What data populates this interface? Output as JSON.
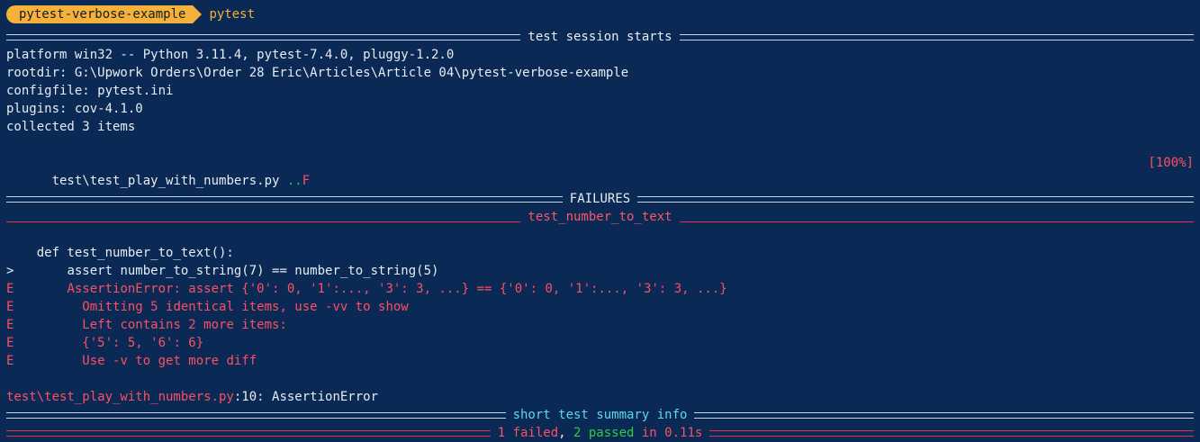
{
  "prompt": {
    "directory": "pytest-verbose-example",
    "command": "pytest"
  },
  "session": {
    "title": "test session starts",
    "platform": "platform win32 -- Python 3.11.4, pytest-7.4.0, pluggy-1.2.0",
    "rootdir": "rootdir: G:\\Upwork Orders\\Order 28 Eric\\Articles\\Article 04\\pytest-verbose-example",
    "configfile": "configfile: pytest.ini",
    "plugins": "plugins: cov-4.1.0",
    "collected": "collected 3 items"
  },
  "progress": {
    "file": "test\\test_play_with_numbers.py ",
    "passed_dots": "..",
    "failed_mark": "F",
    "percent": "[100%]"
  },
  "failures": {
    "title": "FAILURES",
    "test_name": "test_number_to_text",
    "lines": [
      {
        "prefix": "    ",
        "text": "def test_number_to_text():",
        "style": "white"
      },
      {
        "prefix": ">       ",
        "text": "assert number_to_string(7) == number_to_string(5)",
        "style": "white"
      },
      {
        "prefix": "E       ",
        "text": "AssertionError: assert {'0': 0, '1':..., '3': 3, ...} == {'0': 0, '1':..., '3': 3, ...}",
        "style": "red"
      },
      {
        "prefix": "E         ",
        "text": "Omitting 5 identical items, use -vv to show",
        "style": "red"
      },
      {
        "prefix": "E         ",
        "text": "Left contains 2 more items:",
        "style": "red"
      },
      {
        "prefix": "E         ",
        "text": "{'5': 5, '6': 6}",
        "style": "red"
      },
      {
        "prefix": "E         ",
        "text": "Use -v to get more diff",
        "style": "red"
      }
    ],
    "location_file": "test\\test_play_with_numbers.py",
    "location_rest": ":10: AssertionError"
  },
  "summary": {
    "title": "short test summary info",
    "failed": "1 failed",
    "comma": ", ",
    "passed": "2 passed",
    "duration": " in 0.11s"
  },
  "colors": {
    "background": "#0a2a55",
    "text": "#e8ecf2",
    "error": "#ff4e62",
    "pass": "#2ecc40",
    "accent": "#f4b23c",
    "summary_title": "#5fd7e6"
  }
}
